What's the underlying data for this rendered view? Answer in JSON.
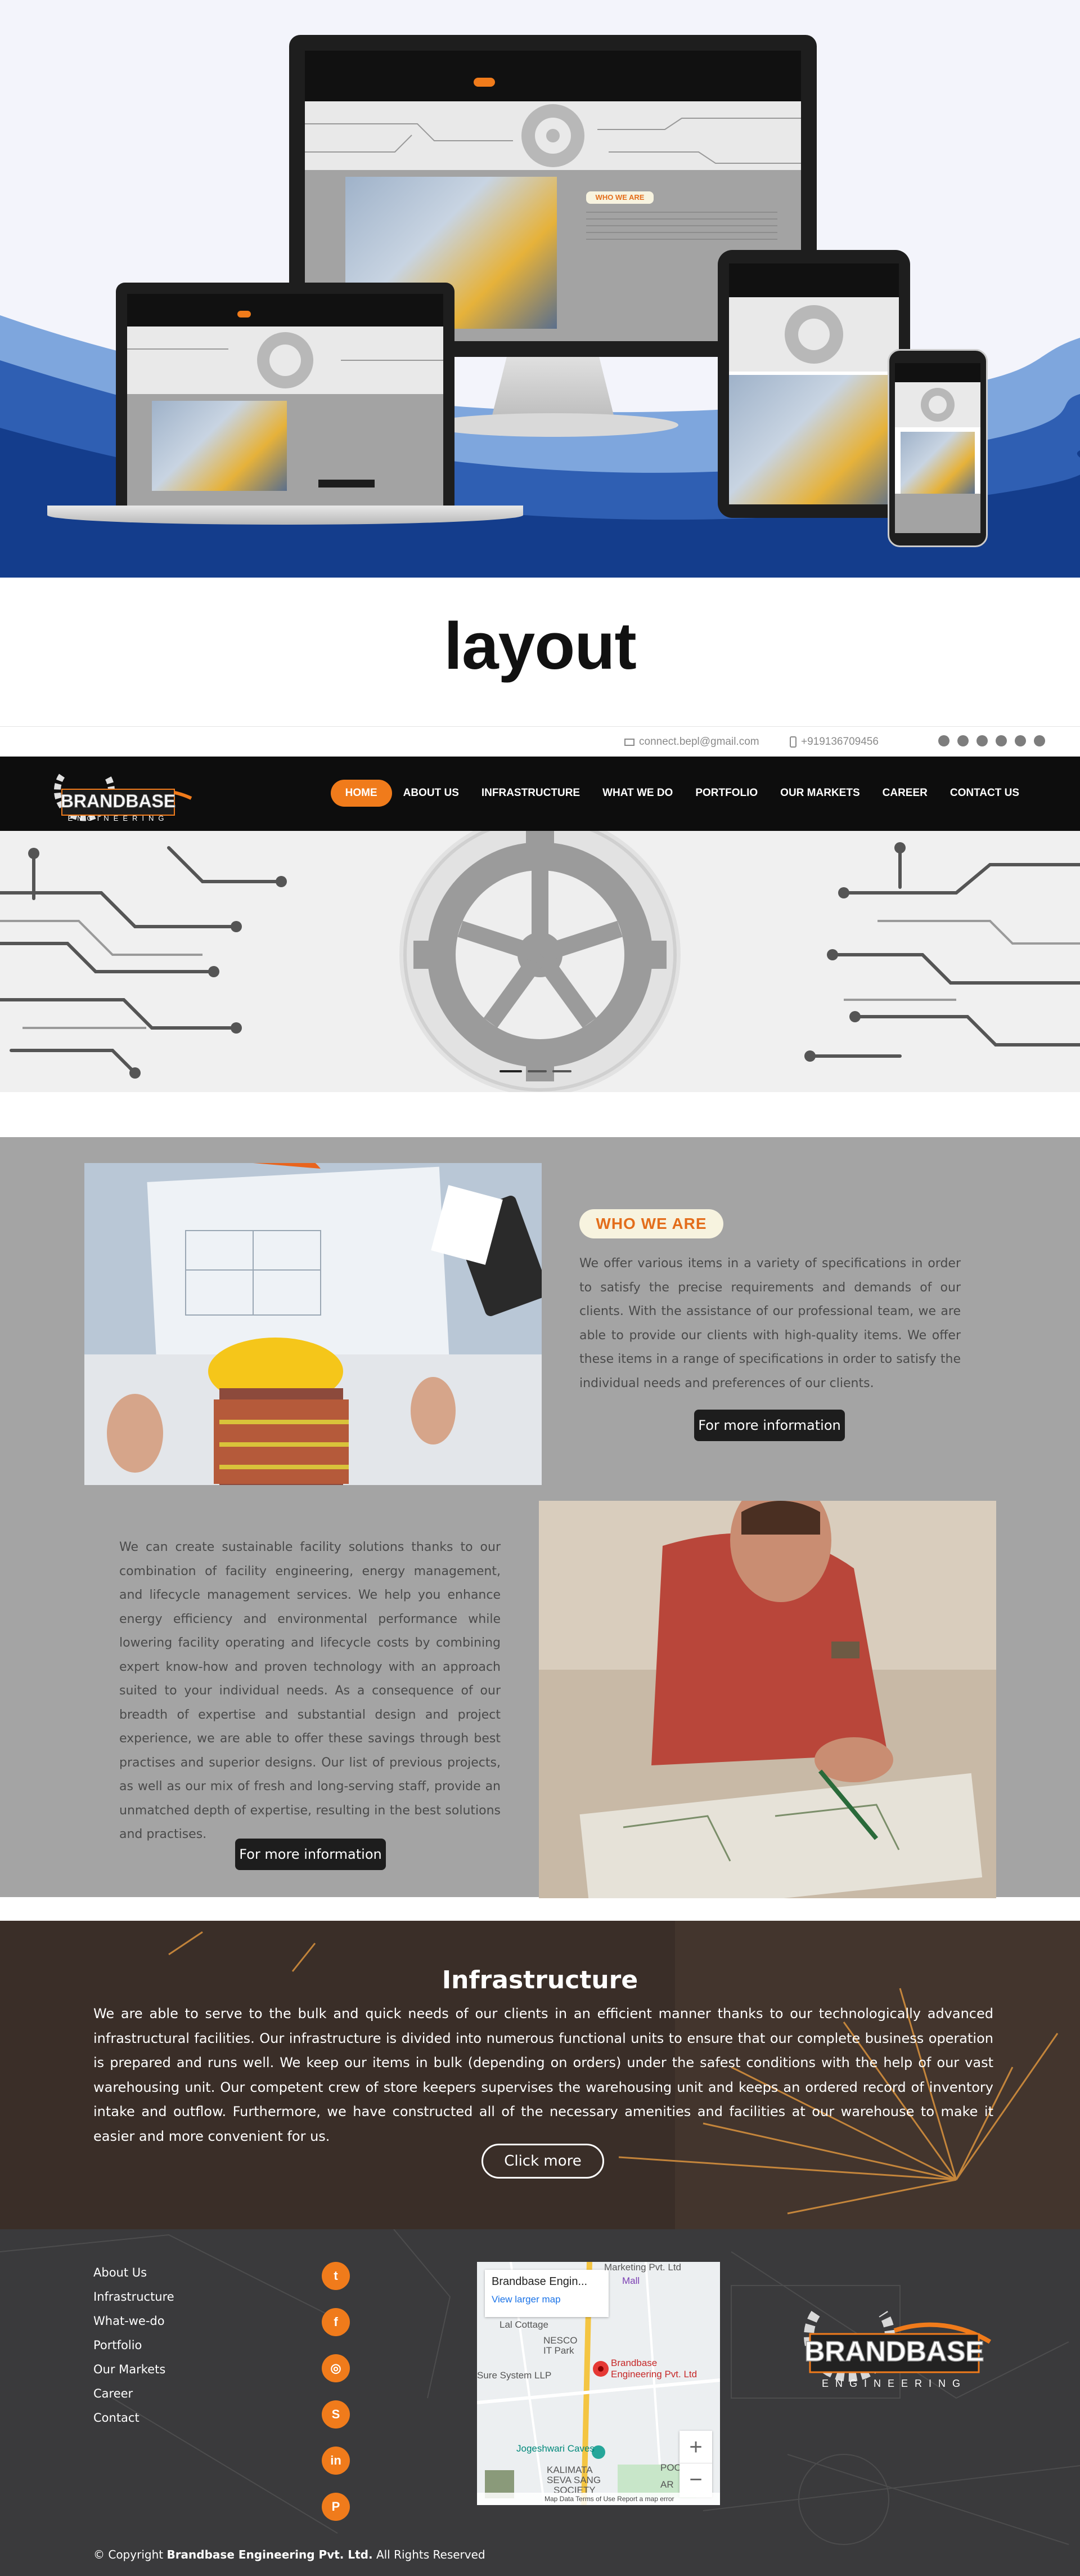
{
  "showcase": {
    "heading": "layout",
    "mini_pill": "WHO WE ARE"
  },
  "topbar": {
    "email": "connect.bepl@gmail.com",
    "phone": "+919136709456",
    "socials": [
      "twitter-icon",
      "facebook-icon",
      "instagram-icon",
      "skype-icon",
      "linkedin-icon",
      "pinterest-icon"
    ]
  },
  "brand": {
    "name": "BRANDBASE",
    "tagline": "ENGINEERING",
    "accent": "#f07b1b"
  },
  "nav": {
    "items": [
      {
        "label": "HOME",
        "active": true
      },
      {
        "label": "ABOUT US"
      },
      {
        "label": "INFRASTRUCTURE"
      },
      {
        "label": "WHAT WE DO"
      },
      {
        "label": "PORTFOLIO"
      },
      {
        "label": "OUR MARKETS"
      },
      {
        "label": "CAREER"
      },
      {
        "label": "CONTACT US"
      }
    ]
  },
  "about": {
    "pill": "WHO WE ARE",
    "para1": "We offer various items in a variety of specifications in order to satisfy the precise requirements and demands of our clients. With the assistance of our professional team, we are able to provide our clients with high-quality items. We offer these items in a range of specifications in order to satisfy the individual needs and preferences of our clients.",
    "button1": "For more information",
    "para2": "We can create sustainable facility solutions thanks to our combination of facility engineering, energy management, and lifecycle management services. We help you enhance energy efficiency and environmental performance while lowering facility operating and lifecycle costs by combining expert know-how and proven technology with an approach suited to your individual needs. As a consequence of our breadth of expertise and substantial design and project experience, we are able to offer these savings through best practises and superior designs. Our list of previous projects, as well as our mix of fresh and long-serving staff, provide an unmatched depth of expertise, resulting in the best solutions and practises.",
    "button2": "For more information"
  },
  "infrastructure": {
    "title": "Infrastructure",
    "text": "We are able to serve to the bulk and quick needs of our clients in an efficient manner thanks to our technologically advanced infrastructural facilities. Our infrastructure is divided into numerous functional units to ensure that our complete business operation is prepared and runs well. We keep our items in bulk (depending on orders) under the safest conditions with the help of our vast warehousing unit. Our competent crew of store keepers supervises the warehousing unit and keeps an ordered record of inventory intake and outflow. Furthermore, we have constructed all of the necessary amenities and facilities at our warehouse to make it easier and more convenient for us.",
    "button": "Click more"
  },
  "footer": {
    "links": [
      "About Us",
      "Infrastructure",
      "What-we-do",
      "Portfolio",
      "Our Markets",
      "Career",
      "Contact"
    ],
    "social_icons": [
      "twitter-icon",
      "facebook-icon",
      "instagram-icon",
      "skype-icon",
      "linkedin-icon",
      "pinterest-icon"
    ],
    "map": {
      "card_title": "Brandbase Engin...",
      "card_link": "View larger map",
      "labels": [
        "Marketing Pvt. Ltd",
        "Mall",
        "Lal Cottage",
        "NESCO",
        "IT Park",
        "Brandbase",
        "Engineering Pvt. Ltd",
        "Sure System LLP",
        "Jogeshwari Caves",
        "KALIMATA",
        "SEVA SANG",
        "SOCIETY",
        "POO",
        "AR"
      ],
      "zoom_in": "+",
      "zoom_out": "−",
      "attribution": "Map Data   Terms of Use   Report a map error"
    },
    "copyright_prefix": "© Copyright",
    "copyright_company": "Brandbase Engineering Pvt. Ltd.",
    "copyright_suffix": "All Rights Reserved"
  }
}
